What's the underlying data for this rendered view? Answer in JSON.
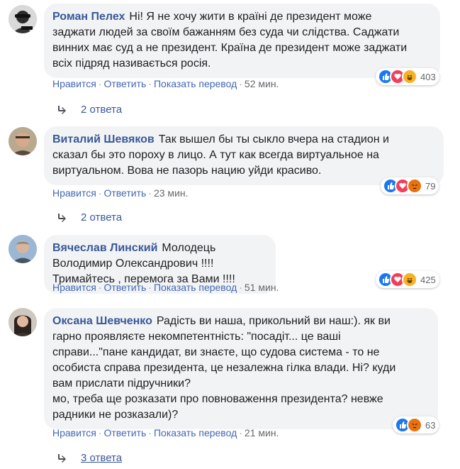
{
  "comments": [
    {
      "author": "Роман Пелех",
      "text": "Ні! Я не хочу жити в країні де президент може\nзаджати людей за своїм бажанням без суда чи слідства. Саджати\nвинних має суд а не президент. Країна де президент може заджати\nвсіх підряд називається росія.",
      "reactions": [
        "like",
        "love",
        "haha"
      ],
      "reaction_count": "403",
      "actions": [
        "Нравится",
        "Ответить",
        "Показать перевод"
      ],
      "time": "52 мин.",
      "replies": "2 ответа"
    },
    {
      "author": "Виталий Шевяков",
      "text": "Так вышел бы ты сыкло вчера на стадион и\nсказал бы это пороху в лицо. А тут как всегда виртуальное на\nвиртуальном. Вова не пазорь нацию уйди красиво.",
      "reactions": [
        "like",
        "love",
        "angry"
      ],
      "reaction_count": "79",
      "actions": [
        "Нравится",
        "Ответить"
      ],
      "time": "23 мин.",
      "replies": "2 ответа"
    },
    {
      "author": "Вячеслав Линский",
      "text": "Молодець Володимир Олександрович !!!!\nТримайтесь , перемога за Вами !!!!",
      "reactions": [
        "like",
        "love",
        "haha"
      ],
      "reaction_count": "425",
      "actions": [
        "Нравится",
        "Ответить",
        "Показать перевод"
      ],
      "time": "51 мин.",
      "replies": null
    },
    {
      "author": "Оксана Шевченко",
      "text": "Радість ви наша, прикольний ви наш:). як ви\nгарно проявляєте некомпетентність: \"посадіт... це ваші\nсправи...\"пане кандидат, ви знаєте, що судова система - то не\nособиста справа президента, це незалежна гілка влади. Ні? куди\nвам прислати підручники?\nмо, треба ще розказати про повноваження президента? невже\nрадники не розказали)?",
      "reactions": [
        "like",
        "angry"
      ],
      "reaction_count": "63",
      "actions": [
        "Нравится",
        "Ответить",
        "Показать перевод"
      ],
      "time": "21 мин.",
      "replies": "3 ответа"
    }
  ],
  "colors": {
    "author": "#385898",
    "bubble": "#f2f3f5",
    "action_link": "#4267b2",
    "meta": "#90949c",
    "like": "#1877f2",
    "love": "#f33e58",
    "haha": "#f7b125",
    "angry": "#e9710f"
  }
}
